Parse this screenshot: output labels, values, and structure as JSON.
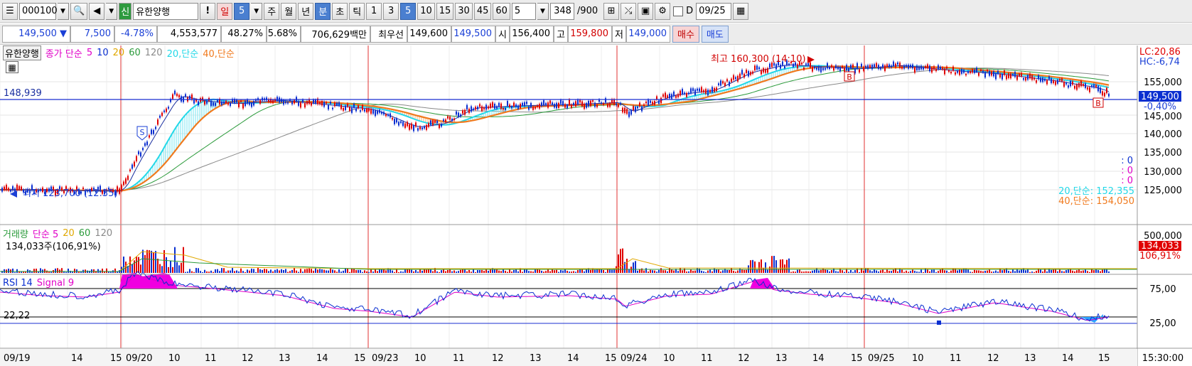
{
  "toolbar": {
    "code": "000100",
    "badge": "신",
    "stock_name": "유한양행",
    "alert": "!",
    "period_day": "일",
    "period_num": "5",
    "periods": [
      "주",
      "월",
      "년"
    ],
    "minute": "분",
    "second": "초",
    "tick": "틱",
    "intervals": [
      "1",
      "3",
      "5",
      "10",
      "15",
      "30",
      "45",
      "60"
    ],
    "count_value": "5",
    "page_count": "348",
    "page_total": "/900",
    "d_label": "D",
    "date": "09/25"
  },
  "quote": {
    "price": "149,500",
    "change": "7,500",
    "change_pct": "-4.78%",
    "volume": "4,553,577",
    "vol_ratio": "48.27%",
    "turnover_pct": "5.68%",
    "amount": "706,629백만",
    "pref_label": "최우선",
    "ask": "149,600",
    "bid": "149,500",
    "open_label": "시",
    "open": "156,400",
    "high_label": "고",
    "high": "159,800",
    "low_label": "저",
    "low": "149,000",
    "buy": "매수",
    "sell": "매도"
  },
  "price_panel": {
    "name": "유한양행",
    "close_label": "종가 단순",
    "ma": [
      "5",
      "10",
      "20",
      "60",
      "120"
    ],
    "ma20_label": "20,단순",
    "ma40_label": "40,단순",
    "hline_value": "148,939",
    "max_label": "최고 160,300 (14:10)",
    "min_label": "최저 123,700 (12:35)",
    "lc": "LC:20,86",
    "hc": "HC:-6,74",
    "current_price": "149,500",
    "current_pct": "-0,40%",
    "ma20_value": "20,단순: 152,355",
    "ma40_value": "40,단순: 154,050",
    "zero_labels": [
      ": 0",
      ": 0",
      ": 0"
    ],
    "axis": [
      "155,000",
      "145,000",
      "140,000",
      "135,000",
      "130,000",
      "125,000"
    ],
    "marker_s": "S",
    "marker_b": "B"
  },
  "volume_panel": {
    "name": "거래량",
    "ma_label": "단순 5",
    "ma": [
      "20",
      "60",
      "120"
    ],
    "value": "134,033주(106,91%)",
    "axis": "500,000",
    "current": "134,033",
    "current_pct": "106,91%"
  },
  "rsi_panel": {
    "name": "RSI 14",
    "signal": "Signal 9",
    "value_left": "22,22",
    "axis": [
      "75,00",
      "25,00"
    ]
  },
  "x_axis": {
    "labels": [
      "09/19",
      "14",
      "15",
      "09/20",
      "10",
      "11",
      "12",
      "13",
      "14",
      "15",
      "09/23",
      "10",
      "11",
      "12",
      "13",
      "14",
      "15",
      "09/24",
      "10",
      "11",
      "12",
      "13",
      "14",
      "15",
      "09/25",
      "10",
      "11",
      "12",
      "13",
      "14",
      "15"
    ],
    "time_right": "15:30:00"
  },
  "colors": {
    "up": "#e00000",
    "down": "#0a2fd0",
    "ma20": "#22d8e8",
    "ma40": "#f07a1e",
    "ma60": "#2a9a3a",
    "ma120": "#8a8a8a",
    "rsi": "#0a2fd0",
    "signal": "#e000c8",
    "accent": "#4a7fd0"
  }
}
